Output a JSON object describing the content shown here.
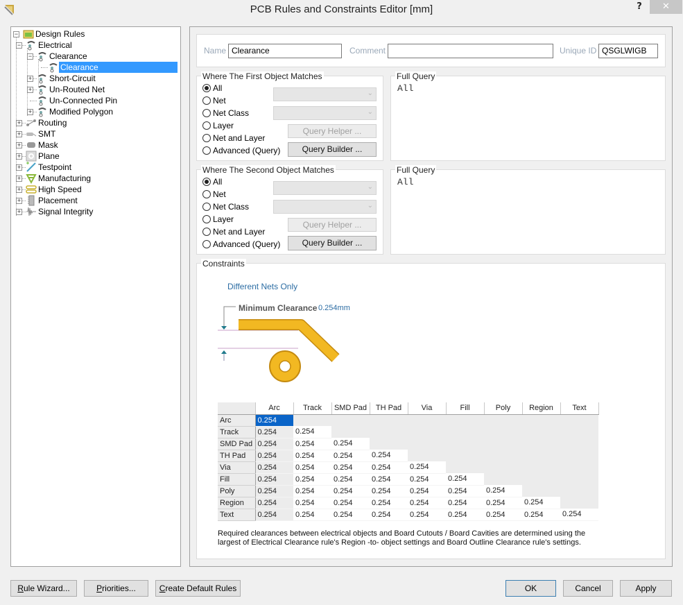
{
  "window": {
    "title": "PCB Rules and Constraints Editor [mm]",
    "help_label": "?",
    "close_label": "✕"
  },
  "tree": {
    "root": {
      "label": "Design Rules",
      "icon": "design-rules-folder-icon",
      "expanded": true
    },
    "items": [
      {
        "label": "Electrical",
        "level": 1,
        "icon": "electrical-rule-icon",
        "expander": "minus"
      },
      {
        "label": "Clearance",
        "level": 2,
        "icon": "electrical-rule-icon",
        "expander": "minus"
      },
      {
        "label": "Clearance",
        "level": 3,
        "icon": "electrical-rule-icon",
        "expander": "none",
        "selected": true
      },
      {
        "label": "Short-Circuit",
        "level": 2,
        "icon": "electrical-rule-icon",
        "expander": "plus"
      },
      {
        "label": "Un-Routed Net",
        "level": 2,
        "icon": "electrical-rule-icon",
        "expander": "plus"
      },
      {
        "label": "Un-Connected Pin",
        "level": 2,
        "icon": "electrical-rule-icon",
        "expander": "none"
      },
      {
        "label": "Modified Polygon",
        "level": 2,
        "icon": "electrical-rule-icon",
        "expander": "plus"
      },
      {
        "label": "Routing",
        "level": 1,
        "icon": "routing-icon",
        "expander": "plus"
      },
      {
        "label": "SMT",
        "level": 1,
        "icon": "smt-icon",
        "expander": "plus"
      },
      {
        "label": "Mask",
        "level": 1,
        "icon": "mask-icon",
        "expander": "plus"
      },
      {
        "label": "Plane",
        "level": 1,
        "icon": "plane-icon",
        "expander": "plus"
      },
      {
        "label": "Testpoint",
        "level": 1,
        "icon": "testpoint-icon",
        "expander": "plus"
      },
      {
        "label": "Manufacturing",
        "level": 1,
        "icon": "manufacturing-icon",
        "expander": "plus"
      },
      {
        "label": "High Speed",
        "level": 1,
        "icon": "high-speed-icon",
        "expander": "plus"
      },
      {
        "label": "Placement",
        "level": 1,
        "icon": "placement-icon",
        "expander": "plus"
      },
      {
        "label": "Signal Integrity",
        "level": 1,
        "icon": "signal-integrity-icon",
        "expander": "plus"
      }
    ]
  },
  "rule": {
    "name_label": "Name",
    "name_value": "Clearance",
    "comment_label": "Comment",
    "comment_value": "",
    "unique_id_label": "Unique ID",
    "unique_id_value": "QSGLWIGB"
  },
  "first_object": {
    "title": "Where The First Object Matches",
    "options": [
      "All",
      "Net",
      "Net Class",
      "Layer",
      "Net and Layer",
      "Advanced (Query)"
    ],
    "selected": "All",
    "query_helper_label": "Query Helper ...",
    "query_builder_label": "Query Builder ...",
    "full_query_title": "Full Query",
    "full_query": "All"
  },
  "second_object": {
    "title": "Where The Second Object Matches",
    "options": [
      "All",
      "Net",
      "Net Class",
      "Layer",
      "Net and Layer",
      "Advanced (Query)"
    ],
    "selected": "All",
    "query_helper_label": "Query Helper ...",
    "query_builder_label": "Query Builder ...",
    "full_query_title": "Full Query",
    "full_query": "All"
  },
  "constraints": {
    "title": "Constraints",
    "net_scope": "Different Nets Only",
    "min_clearance_label": "Minimum Clearance",
    "min_clearance_value": "0.254mm",
    "colors": {
      "copper": "#f2b822",
      "copper_edge": "#c48a10",
      "arrow": "#1f7a8c",
      "guide": "#c8a0c8"
    },
    "matrix": {
      "columns": [
        "Arc",
        "Track",
        "SMD Pad",
        "TH Pad",
        "Via",
        "Fill",
        "Poly",
        "Region",
        "Text"
      ],
      "rows": [
        {
          "label": "Arc",
          "values": [
            "0.254"
          ]
        },
        {
          "label": "Track",
          "values": [
            "0.254",
            "0.254"
          ]
        },
        {
          "label": "SMD Pad",
          "values": [
            "0.254",
            "0.254",
            "0.254"
          ]
        },
        {
          "label": "TH Pad",
          "values": [
            "0.254",
            "0.254",
            "0.254",
            "0.254"
          ]
        },
        {
          "label": "Via",
          "values": [
            "0.254",
            "0.254",
            "0.254",
            "0.254",
            "0.254"
          ]
        },
        {
          "label": "Fill",
          "values": [
            "0.254",
            "0.254",
            "0.254",
            "0.254",
            "0.254",
            "0.254"
          ]
        },
        {
          "label": "Poly",
          "values": [
            "0.254",
            "0.254",
            "0.254",
            "0.254",
            "0.254",
            "0.254",
            "0.254"
          ]
        },
        {
          "label": "Region",
          "values": [
            "0.254",
            "0.254",
            "0.254",
            "0.254",
            "0.254",
            "0.254",
            "0.254",
            "0.254"
          ]
        },
        {
          "label": "Text",
          "values": [
            "0.254",
            "0.254",
            "0.254",
            "0.254",
            "0.254",
            "0.254",
            "0.254",
            "0.254",
            "0.254"
          ]
        }
      ],
      "selected_cell": {
        "row": 0,
        "col": 0
      }
    },
    "note": "Required clearances between electrical objects and Board Cutouts / Board Cavities are determined using the largest of Electrical Clearance rule's Region -to- object settings and Board Outline Clearance rule's settings."
  },
  "footer": {
    "rule_wizard": {
      "mnemonic": "R",
      "rest": "ule Wizard..."
    },
    "priorities": {
      "mnemonic": "P",
      "rest": "riorities..."
    },
    "create_default": {
      "mnemonic": "C",
      "rest": "reate Default Rules"
    },
    "ok": "OK",
    "cancel": "Cancel",
    "apply": "Apply"
  }
}
